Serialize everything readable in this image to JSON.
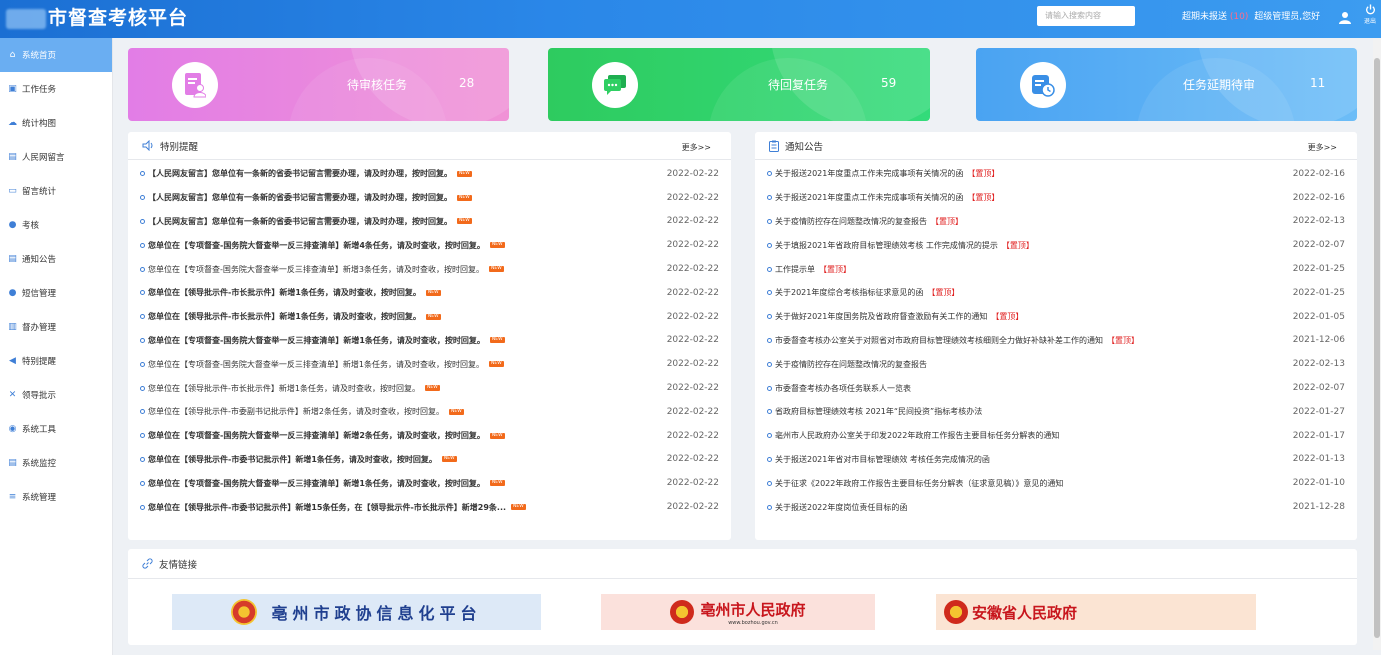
{
  "header": {
    "title": "市督查考核平台",
    "search_placeholder": "请输入搜索内容",
    "overdue_label": "超期未报送",
    "overdue_count": "(10)",
    "greeting": "超级管理员,您好",
    "logout_label": "退出"
  },
  "sidebar": {
    "items": [
      {
        "label": "系统首页",
        "icon": "home-icon"
      },
      {
        "label": "工作任务",
        "icon": "calendar-icon"
      },
      {
        "label": "统计构图",
        "icon": "cloud-icon"
      },
      {
        "label": "人民网留言",
        "icon": "document-icon"
      },
      {
        "label": "留言统计",
        "icon": "folder-icon"
      },
      {
        "label": "考核",
        "icon": "globe-icon"
      },
      {
        "label": "通知公告",
        "icon": "list-icon"
      },
      {
        "label": "短信管理",
        "icon": "globe-icon"
      },
      {
        "label": "督办管理",
        "icon": "clipboard-icon"
      },
      {
        "label": "特别提醒",
        "icon": "speaker-icon"
      },
      {
        "label": "领导批示",
        "icon": "tools-icon"
      },
      {
        "label": "系统工具",
        "icon": "users-icon"
      },
      {
        "label": "系统监控",
        "icon": "monitor-icon"
      },
      {
        "label": "系统管理",
        "icon": "menu-icon"
      }
    ]
  },
  "cards": [
    {
      "label": "待审核任务",
      "count": "28",
      "color": "#e986e8",
      "icon": "document-user-icon"
    },
    {
      "label": "待回复任务",
      "count": "59",
      "color": "#2fd36b",
      "icon": "chat-icon"
    },
    {
      "label": "任务延期待审",
      "count": "11",
      "color": "#5bb0f5",
      "icon": "calendar-clock-icon"
    }
  ],
  "reminders": {
    "title": "特别提醒",
    "more": "更多>>",
    "items": [
      {
        "text": "【人民网友留言】您单位有一条新的省委书记留言需要办理，请及时办理，按时回复。",
        "date": "2022-02-22",
        "bold": true
      },
      {
        "text": "【人民网友留言】您单位有一条新的省委书记留言需要办理，请及时办理，按时回复。",
        "date": "2022-02-22",
        "bold": true
      },
      {
        "text": "【人民网友留言】您单位有一条新的省委书记留言需要办理，请及时办理，按时回复。",
        "date": "2022-02-22",
        "bold": true
      },
      {
        "text": "您单位在【专项督查-国务院大督查举一反三排查清单】新增4条任务，请及时查收，按时回复。",
        "date": "2022-02-22",
        "bold": true
      },
      {
        "text": "您单位在【专项督查-国务院大督查举一反三排查清单】新增3条任务，请及时查收，按时回复。",
        "date": "2022-02-22",
        "bold": false
      },
      {
        "text": "您单位在【领导批示件-市长批示件】新增1条任务，请及时查收，按时回复。",
        "date": "2022-02-22",
        "bold": true
      },
      {
        "text": "您单位在【领导批示件-市长批示件】新增1条任务，请及时查收，按时回复。",
        "date": "2022-02-22",
        "bold": true
      },
      {
        "text": "您单位在【专项督查-国务院大督查举一反三排查清单】新增1条任务，请及时查收，按时回复。",
        "date": "2022-02-22",
        "bold": true
      },
      {
        "text": "您单位在【专项督查-国务院大督查举一反三排查清单】新增1条任务，请及时查收，按时回复。",
        "date": "2022-02-22",
        "bold": false
      },
      {
        "text": "您单位在【领导批示件-市长批示件】新增1条任务，请及时查收，按时回复。",
        "date": "2022-02-22",
        "bold": false
      },
      {
        "text": "您单位在【领导批示件-市委副书记批示件】新增2条任务，请及时查收，按时回复。",
        "date": "2022-02-22",
        "bold": false
      },
      {
        "text": "您单位在【专项督查-国务院大督查举一反三排查清单】新增2条任务，请及时查收，按时回复。",
        "date": "2022-02-22",
        "bold": true
      },
      {
        "text": "您单位在【领导批示件-市委书记批示件】新增1条任务，请及时查收，按时回复。",
        "date": "2022-02-22",
        "bold": true
      },
      {
        "text": "您单位在【专项督查-国务院大督查举一反三排查清单】新增1条任务，请及时查收，按时回复。",
        "date": "2022-02-22",
        "bold": true
      },
      {
        "text": "您单位在【领导批示件-市委书记批示件】新增15条任务，在【领导批示件-市长批示件】新增29条...",
        "date": "2022-02-22",
        "bold": true
      }
    ],
    "new_label": "NEW"
  },
  "notices": {
    "title": "通知公告",
    "more": "更多>>",
    "top_label": "【置顶】",
    "items": [
      {
        "text": "关于报送2021年度重点工作未完成事项有关情况的函",
        "date": "2022-02-16",
        "top": true
      },
      {
        "text": "关于报送2021年度重点工作未完成事项有关情况的函",
        "date": "2022-02-16",
        "top": true
      },
      {
        "text": "关于疫情防控存在问题整改情况的复查报告",
        "date": "2022-02-13",
        "top": true
      },
      {
        "text": "关于填报2021年省政府目标管理绩效考核 工作完成情况的提示",
        "date": "2022-02-07",
        "top": true
      },
      {
        "text": "工作提示单",
        "date": "2022-01-25",
        "top": true
      },
      {
        "text": "关于2021年度综合考核指标征求意见的函",
        "date": "2022-01-25",
        "top": true
      },
      {
        "text": "关于做好2021年度国务院及省政府督查激励有关工作的通知",
        "date": "2022-01-05",
        "top": true
      },
      {
        "text": "市委督查考核办公室关于对照省对市政府目标管理绩效考核细则全力做好补缺补差工作的通知",
        "date": "2021-12-06",
        "top": true
      },
      {
        "text": "关于疫情防控存在问题整改情况的复查报告",
        "date": "2022-02-13",
        "top": false
      },
      {
        "text": "市委督查考核办各项任务联系人一览表",
        "date": "2022-02-07",
        "top": false
      },
      {
        "text": "省政府目标管理绩效考核 2021年“民间投资”指标考核办法",
        "date": "2022-01-27",
        "top": false
      },
      {
        "text": "亳州市人民政府办公室关于印发2022年政府工作报告主要目标任务分解表的通知",
        "date": "2022-01-17",
        "top": false
      },
      {
        "text": "关于报送2021年省对市目标管理绩效 考核任务完成情况的函",
        "date": "2022-01-13",
        "top": false
      },
      {
        "text": "关于征求《2022年政府工作报告主要目标任务分解表（征求意见稿）》意见的通知",
        "date": "2022-01-10",
        "top": false
      },
      {
        "text": "关于报送2022年度岗位责任目标的函",
        "date": "2021-12-28",
        "top": false
      }
    ]
  },
  "links": {
    "title": "友情链接",
    "banners": [
      {
        "label": "亳州市政协信息化平台",
        "color": "#dfeaf8"
      },
      {
        "label": "亳州市人民政府",
        "sub": "www.bozhou.gov.cn",
        "color": "#fbe3df"
      },
      {
        "label": "安徽省人民政府",
        "color": "#fbe6d6"
      }
    ]
  }
}
